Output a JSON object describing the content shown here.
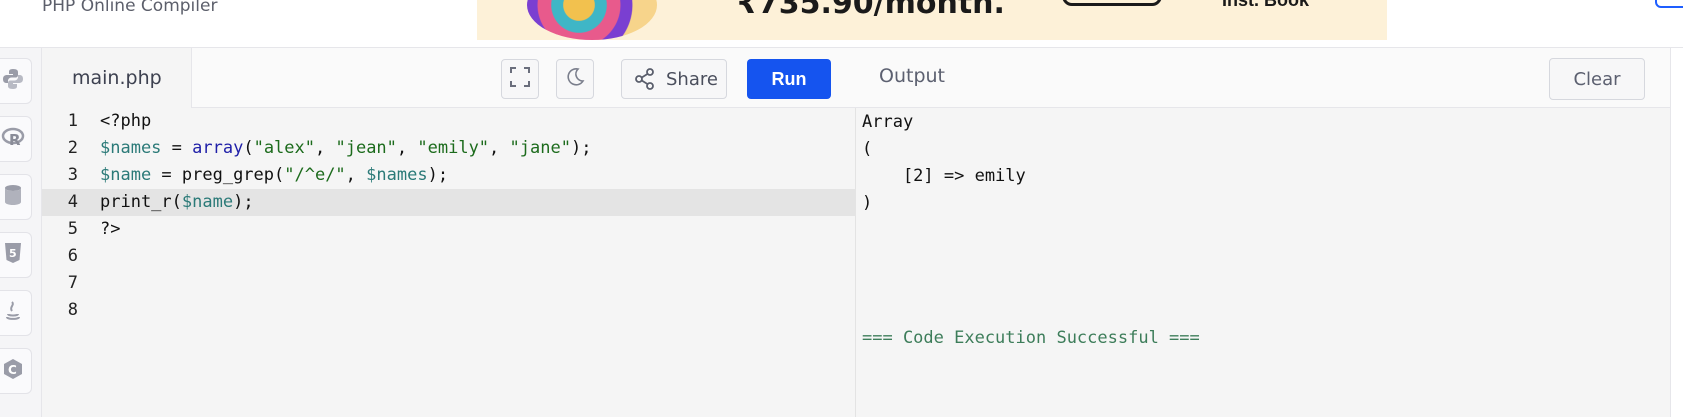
{
  "header": {
    "subtitle": "PHP Online Compiler",
    "ad_price_text": "₹735.90/month.",
    "ad_sub_text": "Inst. Book"
  },
  "sidebar": {
    "items": [
      {
        "icon": "python-icon"
      },
      {
        "icon": "r-icon"
      },
      {
        "icon": "database-icon"
      },
      {
        "icon": "html5-icon"
      },
      {
        "icon": "java-icon"
      },
      {
        "icon": "c-icon"
      }
    ]
  },
  "editor": {
    "file_tab": "main.php",
    "share_label": "Share",
    "run_label": "Run",
    "active_line": 4,
    "lines": [
      {
        "n": "1",
        "tokens": [
          {
            "t": "<?php",
            "c": "plain"
          }
        ]
      },
      {
        "n": "2",
        "tokens": [
          {
            "t": "$names",
            "c": "var"
          },
          {
            "t": " = ",
            "c": "plain"
          },
          {
            "t": "array",
            "c": "kw"
          },
          {
            "t": "(",
            "c": "plain"
          },
          {
            "t": "\"alex\"",
            "c": "str"
          },
          {
            "t": ", ",
            "c": "plain"
          },
          {
            "t": "\"jean\"",
            "c": "str"
          },
          {
            "t": ", ",
            "c": "plain"
          },
          {
            "t": "\"emily\"",
            "c": "str"
          },
          {
            "t": ", ",
            "c": "plain"
          },
          {
            "t": "\"jane\"",
            "c": "str"
          },
          {
            "t": ");",
            "c": "plain"
          }
        ]
      },
      {
        "n": "3",
        "tokens": [
          {
            "t": "$name",
            "c": "var"
          },
          {
            "t": " = preg_grep(",
            "c": "plain"
          },
          {
            "t": "\"/^e/\"",
            "c": "str"
          },
          {
            "t": ", ",
            "c": "plain"
          },
          {
            "t": "$names",
            "c": "var"
          },
          {
            "t": ");",
            "c": "plain"
          }
        ]
      },
      {
        "n": "4",
        "tokens": [
          {
            "t": "print_r(",
            "c": "plain"
          },
          {
            "t": "$name",
            "c": "var"
          },
          {
            "t": ");",
            "c": "plain"
          }
        ]
      },
      {
        "n": "5",
        "tokens": [
          {
            "t": "?>",
            "c": "plain"
          }
        ]
      },
      {
        "n": "6",
        "tokens": []
      },
      {
        "n": "7",
        "tokens": []
      },
      {
        "n": "8",
        "tokens": []
      }
    ]
  },
  "output": {
    "title": "Output",
    "clear_label": "Clear",
    "lines": [
      "Array",
      "(",
      "    [2] => emily",
      ")"
    ],
    "success": "=== Code Execution Successful ==="
  },
  "colors": {
    "accent": "#1554ef",
    "var": "#2b7a78",
    "keyword": "#1f1fa8",
    "string": "#1c6b1c",
    "success": "#3d7d5a"
  }
}
